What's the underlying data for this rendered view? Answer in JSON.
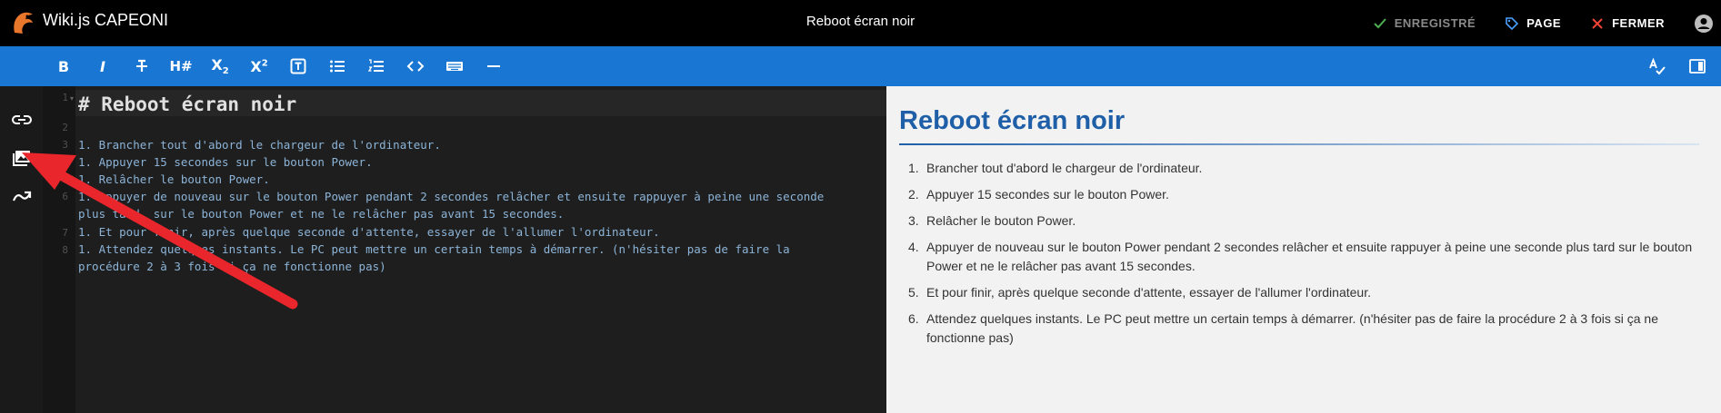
{
  "app": {
    "title": "Wiki.js CAPEONI"
  },
  "page": {
    "title": "Reboot écran noir"
  },
  "top_actions": {
    "saved": "ENREGISTRÉ",
    "page": "PAGE",
    "close": "FERMER"
  },
  "toolbar": {
    "bold_label": "B",
    "italic_label": "I",
    "heading_label": "H#",
    "subscript_label": "X",
    "superscript_label": "X"
  },
  "editor": {
    "line_numbers": [
      "1",
      "2",
      "3",
      "4",
      "5",
      "6",
      "7",
      "8"
    ],
    "heading": "# Reboot écran noir",
    "lines": [
      "1. Brancher tout d'abord le chargeur de l'ordinateur.",
      "1. Appuyer 15 secondes sur le bouton Power.",
      "1. Relâcher le bouton Power.",
      "1. Appuyer de nouveau sur le bouton Power pendant 2 secondes relâcher et ensuite rappuyer à peine une seconde",
      "plus tard  sur le bouton Power et ne le relâcher pas avant 15 secondes.",
      "1. Et pour finir, après quelque seconde d'attente, essayer de l'allumer l'ordinateur.",
      "1. Attendez quelques instants. Le PC peut mettre un certain temps à démarrer. (n'hésiter pas de faire la",
      "procédure 2 à 3 fois si ça ne fonctionne pas)"
    ]
  },
  "preview": {
    "title": "Reboot écran noir",
    "items": [
      {
        "num": "1.",
        "text": "Brancher tout d'abord le chargeur de l'ordinateur."
      },
      {
        "num": "2.",
        "text": "Appuyer 15 secondes sur le bouton Power."
      },
      {
        "num": "3.",
        "text": "Relâcher le bouton Power."
      },
      {
        "num": "4.",
        "text": "Appuyer de nouveau sur le bouton Power pendant 2 secondes relâcher et ensuite rappuyer à peine une seconde plus tard sur le bouton Power et ne le relâcher pas avant 15 secondes."
      },
      {
        "num": "5.",
        "text": "Et pour finir, après quelque seconde d'attente, essayer de l'allumer l'ordinateur."
      },
      {
        "num": "6.",
        "text": "Attendez quelques instants. Le PC peut mettre un certain temps à démarrer. (n'hésiter pas de faire la procédure 2 à 3 fois si ça ne fonctionne pas)"
      }
    ]
  },
  "colors": {
    "toolbar": "#1976d2",
    "heading": "#1f5fa8",
    "annotation_arrow": "#e8262b",
    "saved": "#4caf50"
  },
  "icons": {
    "logo": "wikijs-logo",
    "sidebar": [
      "insert-link-icon",
      "insert-assets-icon",
      "insert-diagram-icon"
    ],
    "toolbar_right": [
      "spellcheck-icon",
      "toggle-preview-icon"
    ]
  }
}
